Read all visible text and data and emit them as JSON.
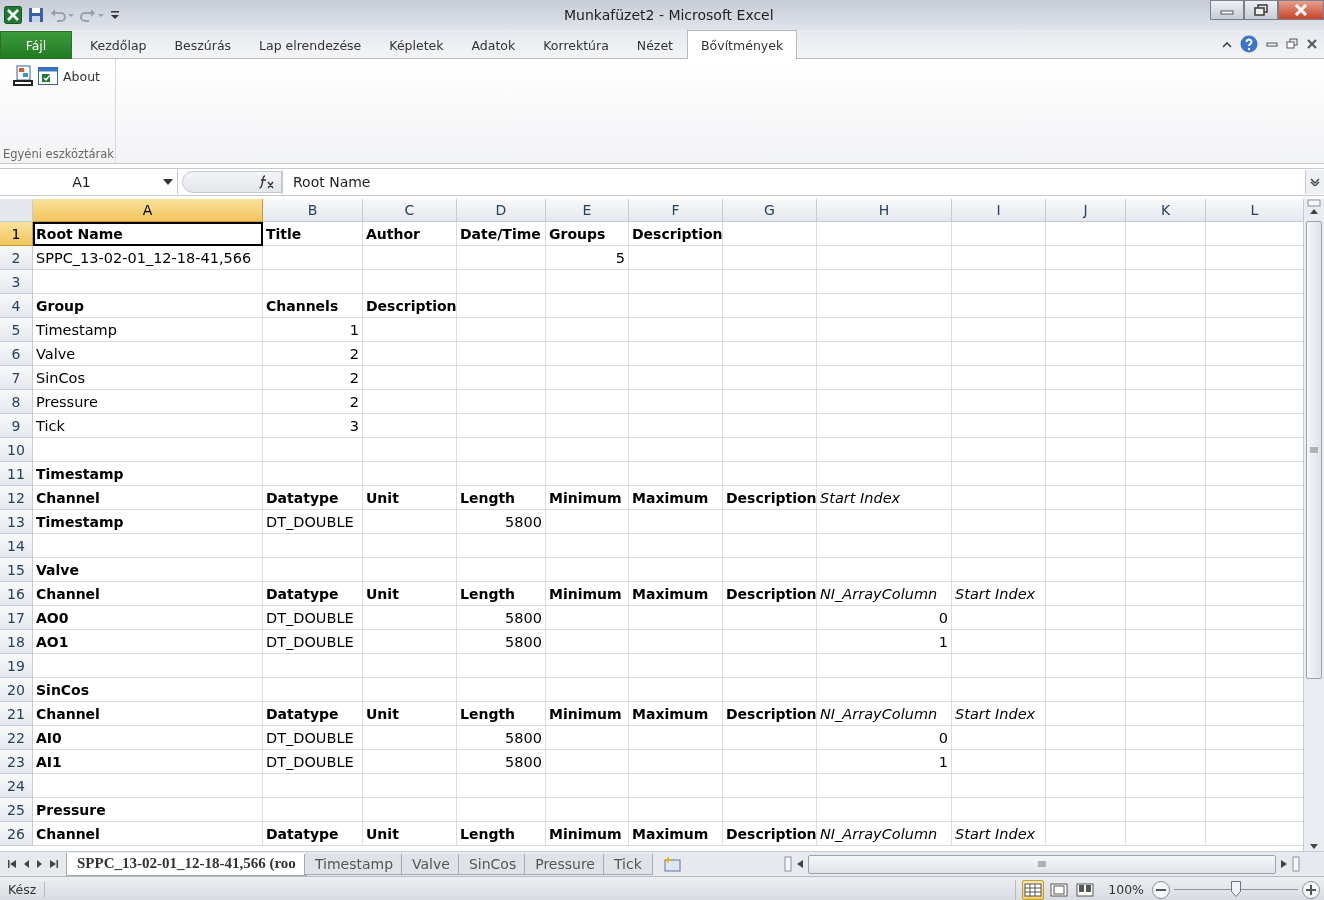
{
  "window": {
    "title": "Munkafüzet2  -  Microsoft Excel"
  },
  "ribbon_tabs": [
    {
      "label": "Fájl",
      "kind": "file",
      "selected": false
    },
    {
      "label": "Kezdőlap",
      "kind": "tab",
      "selected": false
    },
    {
      "label": "Beszúrás",
      "kind": "tab",
      "selected": false
    },
    {
      "label": "Lap elrendezése",
      "kind": "tab",
      "selected": false
    },
    {
      "label": "Képletek",
      "kind": "tab",
      "selected": false
    },
    {
      "label": "Adatok",
      "kind": "tab",
      "selected": false
    },
    {
      "label": "Korrektúra",
      "kind": "tab",
      "selected": false
    },
    {
      "label": "Nézet",
      "kind": "tab",
      "selected": false
    },
    {
      "label": "Bővítmények",
      "kind": "tab",
      "selected": true
    }
  ],
  "ribbon_group": {
    "label": "Egyéni eszköztárak",
    "buttons": [
      {
        "kind": "xls"
      },
      {
        "kind": "about",
        "label": "About"
      }
    ]
  },
  "formula_bar": {
    "name_box": "A1",
    "formula": "Root Name"
  },
  "columns": [
    {
      "label": "A",
      "selected": true
    },
    {
      "label": "B",
      "selected": false
    },
    {
      "label": "C",
      "selected": false
    },
    {
      "label": "D",
      "selected": false
    },
    {
      "label": "E",
      "selected": false
    },
    {
      "label": "F",
      "selected": false
    },
    {
      "label": "G",
      "selected": false
    },
    {
      "label": "H",
      "selected": false
    },
    {
      "label": "I",
      "selected": false
    },
    {
      "label": "J",
      "selected": false
    },
    {
      "label": "K",
      "selected": false
    },
    {
      "label": "L",
      "selected": false
    }
  ],
  "rows": [
    {
      "number": "1",
      "selected": true,
      "cells": [
        {
          "text": "Root Name",
          "kind": "bold",
          "active": true
        },
        {
          "text": "Title",
          "kind": "bold"
        },
        {
          "text": "Author",
          "kind": "bold"
        },
        {
          "text": "Date/Time",
          "kind": "bold"
        },
        {
          "text": "Groups",
          "kind": "bold"
        },
        {
          "text": "Description",
          "kind": "bold"
        }
      ]
    },
    {
      "number": "2",
      "selected": false,
      "cells": [
        {
          "text": "SPPC_13-02-01_12-18-41,566",
          "kind": "text"
        },
        null,
        null,
        null,
        {
          "text": "5",
          "kind": "number"
        }
      ]
    },
    {
      "number": "3",
      "selected": false,
      "cells": []
    },
    {
      "number": "4",
      "selected": false,
      "cells": [
        {
          "text": "Group",
          "kind": "bold"
        },
        {
          "text": "Channels",
          "kind": "bold"
        },
        {
          "text": "Description",
          "kind": "bold"
        }
      ]
    },
    {
      "number": "5",
      "selected": false,
      "cells": [
        {
          "text": "Timestamp",
          "kind": "text"
        },
        {
          "text": "1",
          "kind": "number"
        }
      ]
    },
    {
      "number": "6",
      "selected": false,
      "cells": [
        {
          "text": "Valve",
          "kind": "text"
        },
        {
          "text": "2",
          "kind": "number"
        }
      ]
    },
    {
      "number": "7",
      "selected": false,
      "cells": [
        {
          "text": "SinCos",
          "kind": "text"
        },
        {
          "text": "2",
          "kind": "number"
        }
      ]
    },
    {
      "number": "8",
      "selected": false,
      "cells": [
        {
          "text": "Pressure",
          "kind": "text"
        },
        {
          "text": "2",
          "kind": "number"
        }
      ]
    },
    {
      "number": "9",
      "selected": false,
      "cells": [
        {
          "text": "Tick",
          "kind": "text"
        },
        {
          "text": "3",
          "kind": "number"
        }
      ]
    },
    {
      "number": "10",
      "selected": false,
      "cells": []
    },
    {
      "number": "11",
      "selected": false,
      "cells": [
        {
          "text": "Timestamp",
          "kind": "bold"
        }
      ]
    },
    {
      "number": "12",
      "selected": false,
      "cells": [
        {
          "text": "Channel",
          "kind": "bold"
        },
        {
          "text": "Datatype",
          "kind": "bold"
        },
        {
          "text": "Unit",
          "kind": "bold"
        },
        {
          "text": "Length",
          "kind": "bold"
        },
        {
          "text": "Minimum",
          "kind": "bold"
        },
        {
          "text": "Maximum",
          "kind": "bold"
        },
        {
          "text": "Description",
          "kind": "bold"
        },
        {
          "text": "Start Index",
          "kind": "italic"
        }
      ]
    },
    {
      "number": "13",
      "selected": false,
      "cells": [
        {
          "text": "Timestamp",
          "kind": "bold"
        },
        {
          "text": "DT_DOUBLE",
          "kind": "text"
        },
        null,
        {
          "text": "5800",
          "kind": "number"
        }
      ]
    },
    {
      "number": "14",
      "selected": false,
      "cells": []
    },
    {
      "number": "15",
      "selected": false,
      "cells": [
        {
          "text": "Valve",
          "kind": "bold"
        }
      ]
    },
    {
      "number": "16",
      "selected": false,
      "cells": [
        {
          "text": "Channel",
          "kind": "bold"
        },
        {
          "text": "Datatype",
          "kind": "bold"
        },
        {
          "text": "Unit",
          "kind": "bold"
        },
        {
          "text": "Length",
          "kind": "bold"
        },
        {
          "text": "Minimum",
          "kind": "bold"
        },
        {
          "text": "Maximum",
          "kind": "bold"
        },
        {
          "text": "Description",
          "kind": "bold"
        },
        {
          "text": "NI_ArrayColumn",
          "kind": "italic"
        },
        {
          "text": "Start Index",
          "kind": "italic"
        }
      ]
    },
    {
      "number": "17",
      "selected": false,
      "cells": [
        {
          "text": "AO0",
          "kind": "bold"
        },
        {
          "text": "DT_DOUBLE",
          "kind": "text"
        },
        null,
        {
          "text": "5800",
          "kind": "number"
        },
        null,
        null,
        null,
        {
          "text": "0",
          "kind": "number"
        }
      ]
    },
    {
      "number": "18",
      "selected": false,
      "cells": [
        {
          "text": "AO1",
          "kind": "bold"
        },
        {
          "text": "DT_DOUBLE",
          "kind": "text"
        },
        null,
        {
          "text": "5800",
          "kind": "number"
        },
        null,
        null,
        null,
        {
          "text": "1",
          "kind": "number"
        }
      ]
    },
    {
      "number": "19",
      "selected": false,
      "cells": []
    },
    {
      "number": "20",
      "selected": false,
      "cells": [
        {
          "text": "SinCos",
          "kind": "bold"
        }
      ]
    },
    {
      "number": "21",
      "selected": false,
      "cells": [
        {
          "text": "Channel",
          "kind": "bold"
        },
        {
          "text": "Datatype",
          "kind": "bold"
        },
        {
          "text": "Unit",
          "kind": "bold"
        },
        {
          "text": "Length",
          "kind": "bold"
        },
        {
          "text": "Minimum",
          "kind": "bold"
        },
        {
          "text": "Maximum",
          "kind": "bold"
        },
        {
          "text": "Description",
          "kind": "bold"
        },
        {
          "text": "NI_ArrayColumn",
          "kind": "italic"
        },
        {
          "text": "Start Index",
          "kind": "italic"
        }
      ]
    },
    {
      "number": "22",
      "selected": false,
      "cells": [
        {
          "text": "AI0",
          "kind": "bold"
        },
        {
          "text": "DT_DOUBLE",
          "kind": "text"
        },
        null,
        {
          "text": "5800",
          "kind": "number"
        },
        null,
        null,
        null,
        {
          "text": "0",
          "kind": "number"
        }
      ]
    },
    {
      "number": "23",
      "selected": false,
      "cells": [
        {
          "text": "AI1",
          "kind": "bold"
        },
        {
          "text": "DT_DOUBLE",
          "kind": "text"
        },
        null,
        {
          "text": "5800",
          "kind": "number"
        },
        null,
        null,
        null,
        {
          "text": "1",
          "kind": "number"
        }
      ]
    },
    {
      "number": "24",
      "selected": false,
      "cells": []
    },
    {
      "number": "25",
      "selected": false,
      "cells": [
        {
          "text": "Pressure",
          "kind": "bold"
        }
      ]
    },
    {
      "number": "26",
      "selected": false,
      "cells": [
        {
          "text": "Channel",
          "kind": "bold"
        },
        {
          "text": "Datatype",
          "kind": "bold"
        },
        {
          "text": "Unit",
          "kind": "bold"
        },
        {
          "text": "Length",
          "kind": "bold"
        },
        {
          "text": "Minimum",
          "kind": "bold"
        },
        {
          "text": "Maximum",
          "kind": "bold"
        },
        {
          "text": "Description",
          "kind": "bold"
        },
        {
          "text": "NI_ArrayColumn",
          "kind": "italic"
        },
        {
          "text": "Start Index",
          "kind": "italic"
        }
      ]
    }
  ],
  "sheet_tabs": [
    {
      "label": "SPPC_13-02-01_12-18-41,566 (roo",
      "selected": true
    },
    {
      "label": "Timestamp",
      "selected": false
    },
    {
      "label": "Valve",
      "selected": false
    },
    {
      "label": "SinCos",
      "selected": false
    },
    {
      "label": "Pressure",
      "selected": false
    },
    {
      "label": "Tick",
      "selected": false
    }
  ],
  "status_bar": {
    "status": "Kész",
    "views": [
      {
        "kind": "normal",
        "selected": true
      },
      {
        "kind": "layout",
        "selected": false
      },
      {
        "kind": "pagebreak",
        "selected": false
      }
    ],
    "zoom": "100%",
    "zoom_slider": {
      "level": 0.5
    }
  }
}
